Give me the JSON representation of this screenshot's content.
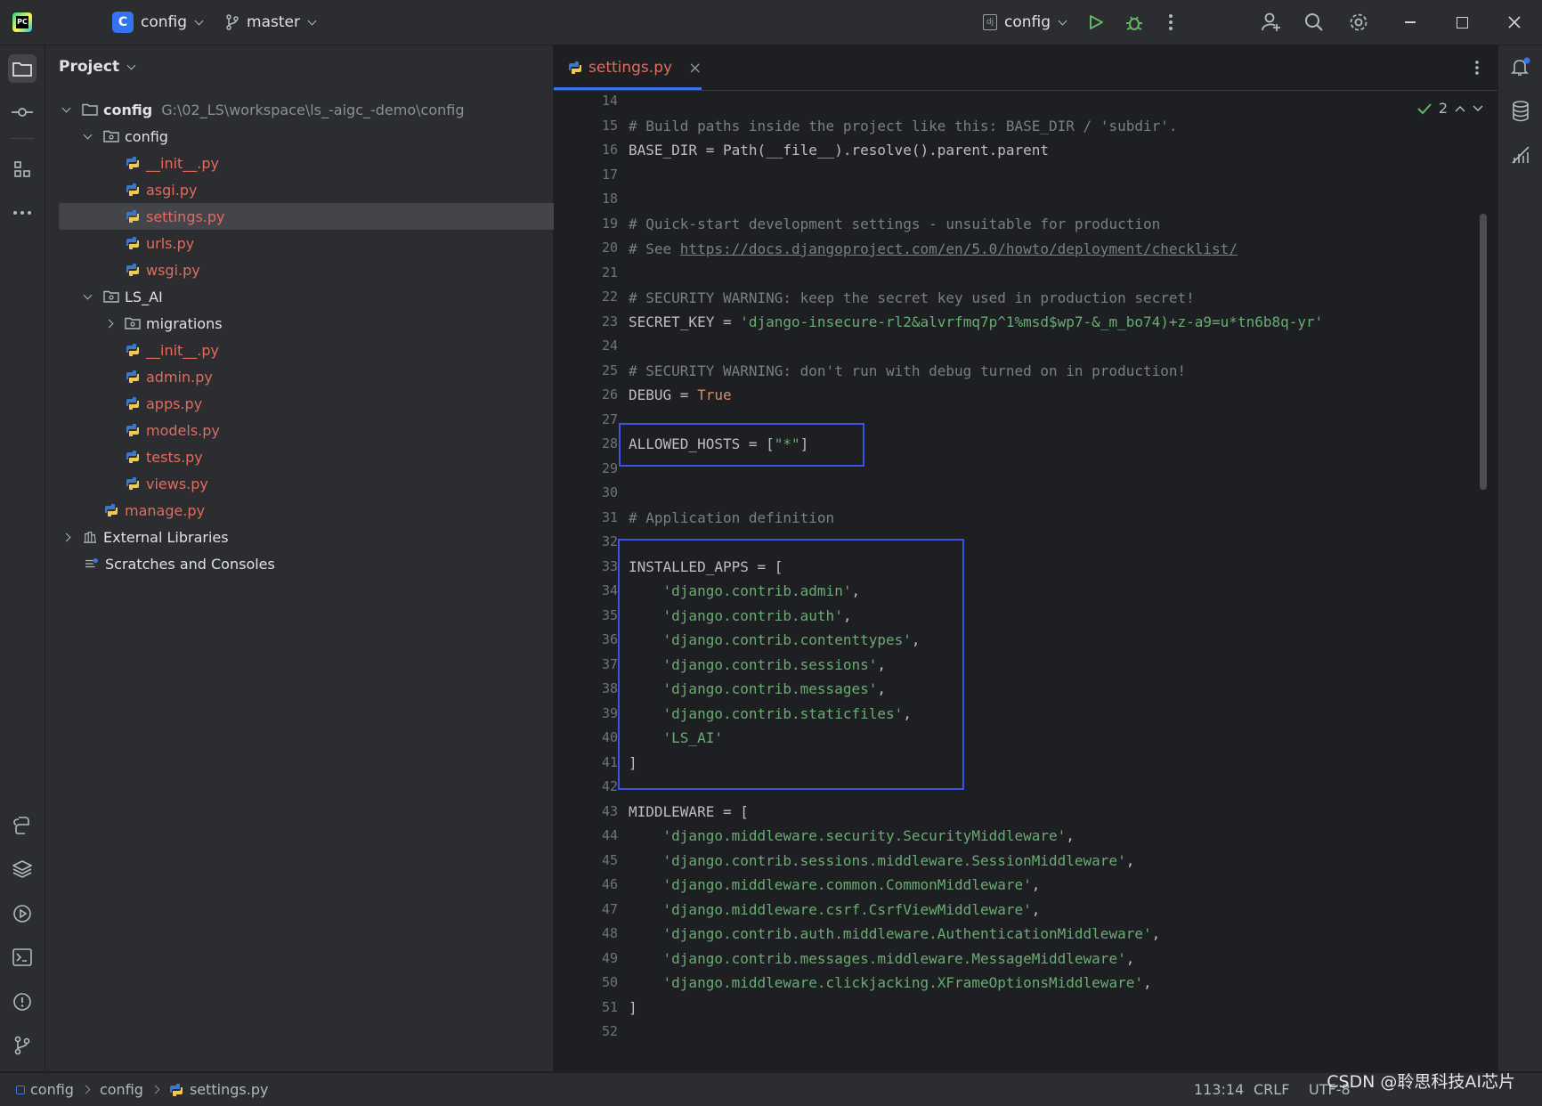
{
  "titlebar": {
    "project_badge": "C",
    "project_name": "config",
    "branch": "master",
    "run_config": "config",
    "icons": [
      "hamburger-menu-icon",
      "branch-icon",
      "run-icon",
      "debug-icon",
      "more-icon",
      "add-user-icon",
      "search-icon",
      "gear-icon",
      "minimize-icon",
      "maximize-icon",
      "close-icon"
    ]
  },
  "project_panel": {
    "header": "Project",
    "root": {
      "name": "config",
      "path": "G:\\02_LS\\workspace\\ls_-aigc_-demo\\config"
    },
    "items": [
      {
        "label": "config",
        "type": "package",
        "expanded": true
      },
      {
        "label": "__init__.py",
        "type": "py"
      },
      {
        "label": "asgi.py",
        "type": "py"
      },
      {
        "label": "settings.py",
        "type": "py",
        "selected": true
      },
      {
        "label": "urls.py",
        "type": "py"
      },
      {
        "label": "wsgi.py",
        "type": "py"
      },
      {
        "label": "LS_AI",
        "type": "package",
        "expanded": true
      },
      {
        "label": "migrations",
        "type": "package",
        "expanded": false
      },
      {
        "label": "__init__.py",
        "type": "py"
      },
      {
        "label": "admin.py",
        "type": "py"
      },
      {
        "label": "apps.py",
        "type": "py"
      },
      {
        "label": "models.py",
        "type": "py"
      },
      {
        "label": "tests.py",
        "type": "py"
      },
      {
        "label": "views.py",
        "type": "py"
      },
      {
        "label": "manage.py",
        "type": "py"
      },
      {
        "label": "External Libraries",
        "type": "library"
      },
      {
        "label": "Scratches and Consoles",
        "type": "scratch"
      }
    ]
  },
  "editor": {
    "tab": {
      "label": "settings.py",
      "close": "×"
    },
    "inspection_count": "2",
    "line_numbers": [
      "14",
      "15",
      "16",
      "17",
      "18",
      "19",
      "20",
      "21",
      "22",
      "23",
      "24",
      "25",
      "26",
      "27",
      "28",
      "29",
      "30",
      "31",
      "32",
      "33",
      "34",
      "35",
      "36",
      "37",
      "38",
      "39",
      "40",
      "41",
      "42",
      "43",
      "44",
      "45",
      "46",
      "47",
      "48",
      "49",
      "50",
      "51",
      "52"
    ],
    "lines": {
      "l15": "# Build paths inside the project like this: BASE_DIR / 'subdir'.",
      "l16": "BASE_DIR = Path(__file__).resolve().parent.parent",
      "l19": "# Quick-start development settings - unsuitable for production",
      "l20a": "# See ",
      "l20b": "https://docs.djangoproject.com/en/5.0/howto/deployment/checklist/",
      "l22": "# SECURITY WARNING: keep the secret key used in production secret!",
      "l23a": "SECRET_KEY = ",
      "l23b": "'django-insecure-rl2&alvrfmq7p^1%msd$wp7-&_m_bo74)+z-a9=u*tn6b8q-yr'",
      "l25": "# SECURITY WARNING: don't run with debug turned on in production!",
      "l26a": "DEBUG = ",
      "l26b": "True",
      "l28a": "ALLOWED_HOSTS = [",
      "l28b": "\"*\"",
      "l28c": "]",
      "l31": "# Application definition",
      "l33": "INSTALLED_APPS = [",
      "l34": "'django.contrib.admin'",
      "l35": "'django.contrib.auth'",
      "l36": "'django.contrib.contenttypes'",
      "l37": "'django.contrib.sessions'",
      "l38": "'django.contrib.messages'",
      "l39": "'django.contrib.staticfiles'",
      "l40": "'LS_AI'",
      "l41": "]",
      "l43": "MIDDLEWARE = [",
      "l44": "'django.middleware.security.SecurityMiddleware'",
      "l45": "'django.contrib.sessions.middleware.SessionMiddleware'",
      "l46": "'django.middleware.common.CommonMiddleware'",
      "l47": "'django.middleware.csrf.CsrfViewMiddleware'",
      "l48": "'django.contrib.auth.middleware.AuthenticationMiddleware'",
      "l49": "'django.contrib.messages.middleware.MessageMiddleware'",
      "l50": "'django.middleware.clickjacking.XFrameOptionsMiddleware'",
      "l51": "]",
      "comma": ","
    }
  },
  "statusbar": {
    "breadcrumb": [
      "config",
      "config",
      "settings.py"
    ],
    "position": "113:14",
    "line_ending": "CRLF",
    "encoding": "UTF-8"
  },
  "watermark": "CSDN @聆思科技AI芯片",
  "colors": {
    "accent": "#3574f0",
    "highlight_box": "#3d52e8",
    "string": "#6aab73",
    "keyword": "#cf8e6d",
    "comment": "#7a7e85",
    "error_file": "#e06c60"
  }
}
